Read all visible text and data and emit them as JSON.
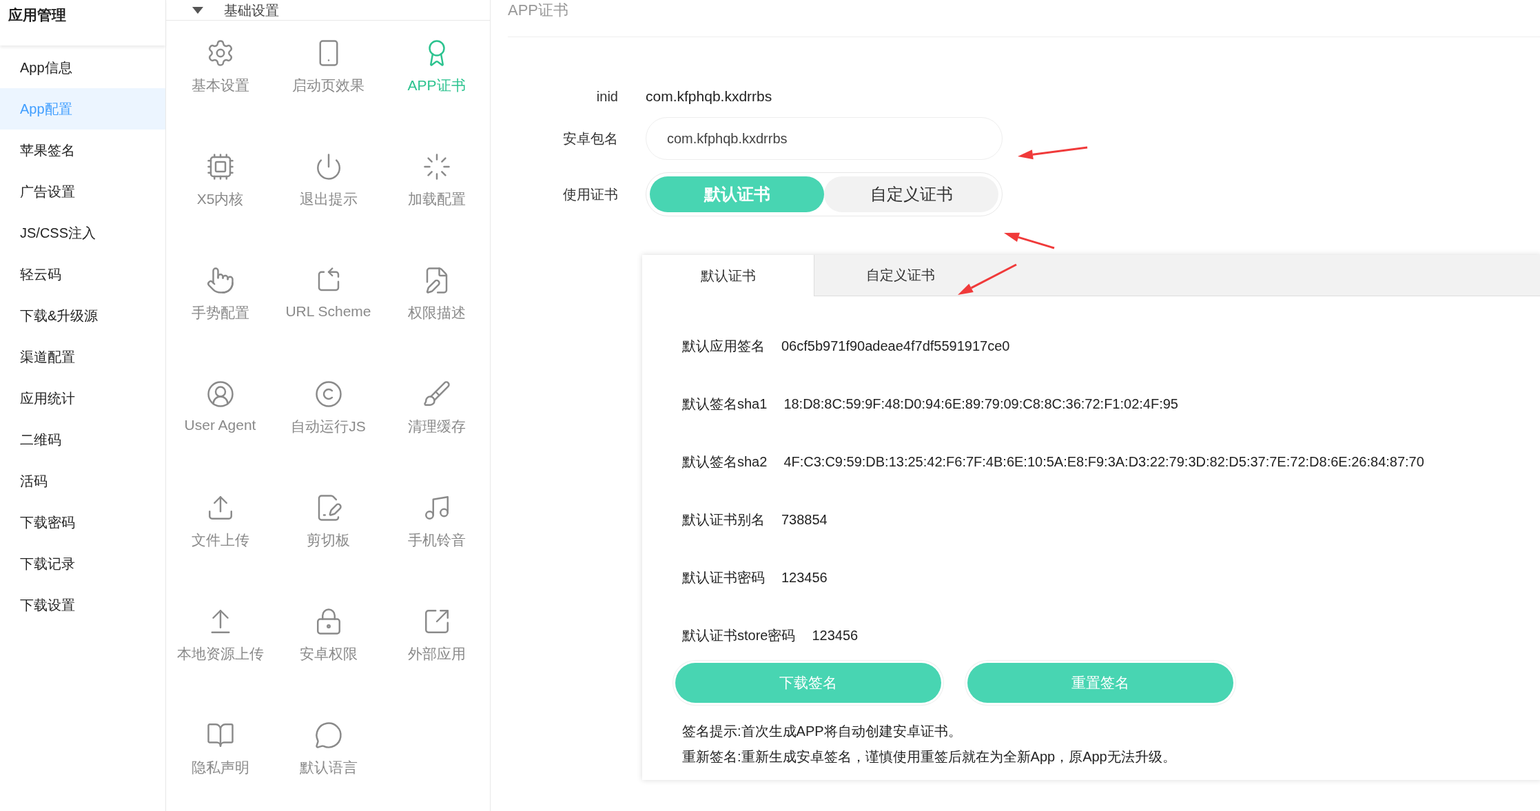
{
  "sidebar": {
    "title": "应用管理",
    "items": [
      {
        "label": "App信息",
        "selected": false
      },
      {
        "label": "App配置",
        "selected": true
      },
      {
        "label": "苹果签名",
        "selected": false
      },
      {
        "label": "广告设置",
        "selected": false
      },
      {
        "label": "JS/CSS注入",
        "selected": false
      },
      {
        "label": "轻云码",
        "selected": false
      },
      {
        "label": "下载&升级源",
        "selected": false
      },
      {
        "label": "渠道配置",
        "selected": false
      },
      {
        "label": "应用统计",
        "selected": false
      },
      {
        "label": "二维码",
        "selected": false
      },
      {
        "label": "活码",
        "selected": false
      },
      {
        "label": "下载密码",
        "selected": false
      },
      {
        "label": "下载记录",
        "selected": false
      },
      {
        "label": "下载设置",
        "selected": false
      }
    ]
  },
  "features": {
    "section": {
      "title": "基础设置",
      "expanded": true
    },
    "items": [
      {
        "label": "基本设置",
        "selected": false
      },
      {
        "label": "启动页效果",
        "selected": false
      },
      {
        "label": "APP证书",
        "selected": true
      },
      {
        "label": "X5内核",
        "selected": false
      },
      {
        "label": "退出提示",
        "selected": false
      },
      {
        "label": "加载配置",
        "selected": false
      },
      {
        "label": "手势配置",
        "selected": false
      },
      {
        "label": "URL Scheme",
        "selected": false
      },
      {
        "label": "权限描述",
        "selected": false
      },
      {
        "label": "User Agent",
        "selected": false
      },
      {
        "label": "自动运行JS",
        "selected": false
      },
      {
        "label": "清理缓存",
        "selected": false
      },
      {
        "label": "文件上传",
        "selected": false
      },
      {
        "label": "剪切板",
        "selected": false
      },
      {
        "label": "手机铃音",
        "selected": false
      },
      {
        "label": "本地资源上传",
        "selected": false
      },
      {
        "label": "安卓权限",
        "selected": false
      },
      {
        "label": "外部应用",
        "selected": false
      },
      {
        "label": "隐私声明",
        "selected": false
      },
      {
        "label": "默认语言",
        "selected": false
      }
    ]
  },
  "main": {
    "title": "APP证书",
    "inid": {
      "label": "inid",
      "value": "com.kfphqb.kxdrrbs"
    },
    "package": {
      "label": "安卓包名",
      "value": "com.kfphqb.kxdrrbs"
    },
    "certificate": {
      "label": "使用证书",
      "options": [
        {
          "label": "默认证书",
          "selected": true
        },
        {
          "label": "自定义证书",
          "selected": false
        }
      ]
    },
    "card": {
      "tabs": [
        {
          "label": "默认证书",
          "selected": true
        },
        {
          "label": "自定义证书",
          "selected": false
        }
      ],
      "rows": [
        {
          "label": "默认应用签名",
          "value": "06cf5b971f90adeae4f7df5591917ce0"
        },
        {
          "label": "默认签名sha1",
          "value": "18:D8:8C:59:9F:48:D0:94:6E:89:79:09:C8:8C:36:72:F1:02:4F:95"
        },
        {
          "label": "默认签名sha2",
          "value": "4F:C3:C9:59:DB:13:25:42:F6:7F:4B:6E:10:5A:E8:F9:3A:D3:22:79:3D:82:D5:37:7E:72:D8:6E:26:84:87:70"
        },
        {
          "label": "默认证书别名",
          "value": "738854"
        },
        {
          "label": "默认证书密码",
          "value": "123456"
        },
        {
          "label": "默认证书store密码",
          "value": "123456"
        }
      ],
      "buttons": [
        "下载签名",
        "重置签名"
      ],
      "notes": [
        "签名提示:首次生成APP将自动创建安卓证书。",
        "重新签名:重新生成安卓签名，谨慎使用重签后就在为全新App，原App无法升级。"
      ]
    }
  }
}
